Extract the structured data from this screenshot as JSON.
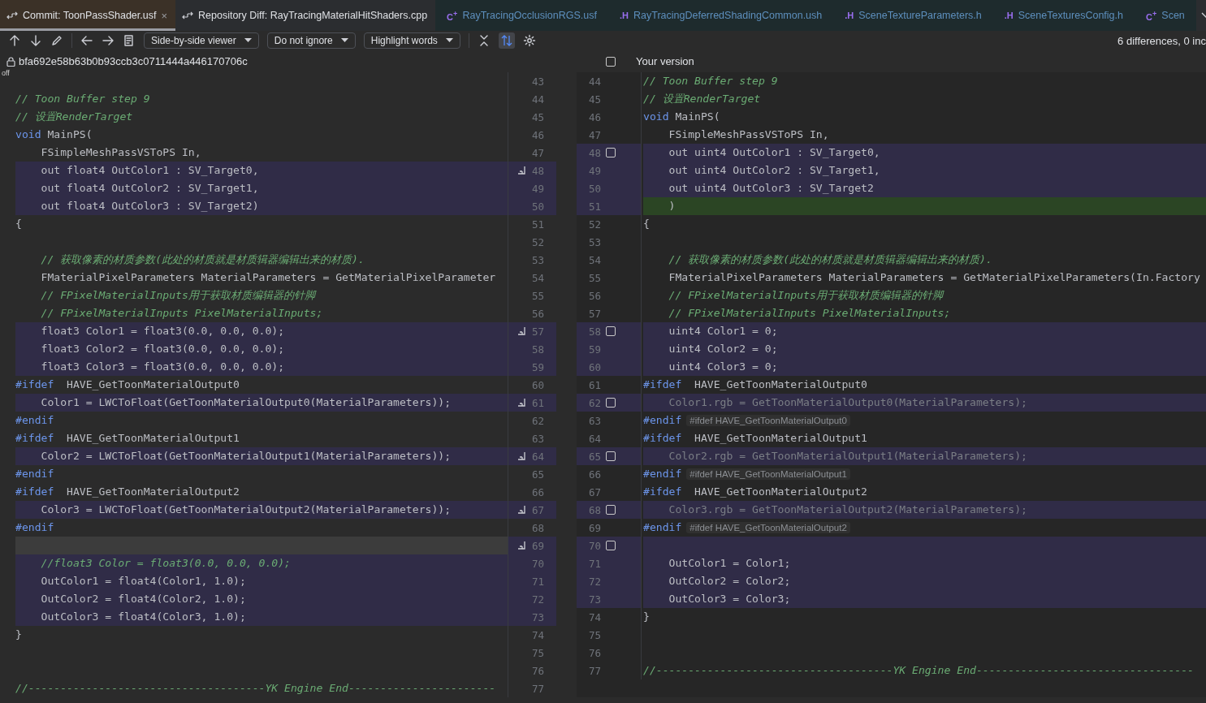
{
  "tabs": [
    {
      "label": "Commit: ToonPassShader.usf",
      "kind": "diff",
      "selected": true,
      "close": "×"
    },
    {
      "label": "Repository Diff: RayTracingMaterialHitShaders.cpp",
      "kind": "diff",
      "selected": false
    },
    {
      "label": "RayTracingOcclusionRGS.usf",
      "kind": "file",
      "badge": "C$^{+}$",
      "selected": false
    },
    {
      "label": "RayTracingDeferredShadingCommon.ush",
      "kind": "file",
      "badge": ".H",
      "selected": false
    },
    {
      "label": "SceneTextureParameters.h",
      "kind": "file",
      "badge": ".H",
      "selected": false
    },
    {
      "label": "SceneTexturesConfig.h",
      "kind": "file",
      "badge": ".H",
      "selected": false
    },
    {
      "label": "Scen",
      "kind": "file",
      "badge": "C$^{+}$",
      "selected": false
    }
  ],
  "toolbar": {
    "dropdowns": [
      "Side-by-side viewer",
      "Do not ignore",
      "Highlight words"
    ],
    "sync_scroll_on": true,
    "summary": "6 differences, 0 inc"
  },
  "left": {
    "revision": "bfa692e58b63b0b93ccb3c0711444a446170706c",
    "fold_label": "off",
    "lines": [
      {
        "no": "43",
        "kind": "blank",
        "changed": false
      },
      {
        "no": "44",
        "kind": "comment",
        "changed": false,
        "text": "// Toon Buffer step 9"
      },
      {
        "no": "45",
        "kind": "comment",
        "changed": false,
        "text": "// 设置RenderTarget"
      },
      {
        "no": "46",
        "kind": "keyword",
        "changed": false,
        "text": "void MainPS("
      },
      {
        "no": "47",
        "kind": "code",
        "changed": false,
        "text": "    FSimpleMeshPassVSToPS In,"
      },
      {
        "no": "48",
        "kind": "code",
        "changed": true,
        "apply": true,
        "text": "    out float4 OutColor1 : SV_Target0,"
      },
      {
        "no": "49",
        "kind": "code",
        "changed": true,
        "text": "    out float4 OutColor2 : SV_Target1,"
      },
      {
        "no": "50",
        "kind": "code",
        "changed": true,
        "text": "    out float4 OutColor3 : SV_Target2)"
      },
      {
        "no": "51",
        "kind": "code",
        "changed": false,
        "text": "{"
      },
      {
        "no": "52",
        "kind": "blank",
        "changed": false
      },
      {
        "no": "53",
        "kind": "comment",
        "changed": false,
        "text": "    // 获取像素的材质参数(此处的材质就是材质辑器编辑出来的材质)."
      },
      {
        "no": "54",
        "kind": "code",
        "changed": false,
        "text": "    FMaterialPixelParameters MaterialParameters = GetMaterialPixelParameter"
      },
      {
        "no": "55",
        "kind": "comment",
        "changed": false,
        "text": "    // FPixelMaterialInputs用于获取材质编辑器的针脚"
      },
      {
        "no": "56",
        "kind": "comment",
        "changed": false,
        "text": "    // FPixelMaterialInputs PixelMaterialInputs;"
      },
      {
        "no": "57",
        "kind": "code",
        "changed": true,
        "apply": true,
        "text": "    float3 Color1 = float3(0.0, 0.0, 0.0);"
      },
      {
        "no": "58",
        "kind": "code",
        "changed": true,
        "text": "    float3 Color2 = float3(0.0, 0.0, 0.0);"
      },
      {
        "no": "59",
        "kind": "code",
        "changed": true,
        "text": "    float3 Color3 = float3(0.0, 0.0, 0.0);"
      },
      {
        "no": "60",
        "kind": "keyword",
        "changed": false,
        "text": "#ifdef  HAVE_GetToonMaterialOutput0"
      },
      {
        "no": "61",
        "kind": "code",
        "changed": true,
        "apply": true,
        "text": "    Color1 = LWCToFloat(GetToonMaterialOutput0(MaterialParameters));"
      },
      {
        "no": "62",
        "kind": "keyword",
        "changed": false,
        "text": "#endif"
      },
      {
        "no": "63",
        "kind": "keyword",
        "changed": false,
        "text": "#ifdef  HAVE_GetToonMaterialOutput1"
      },
      {
        "no": "64",
        "kind": "code",
        "changed": true,
        "apply": true,
        "text": "    Color2 = LWCToFloat(GetToonMaterialOutput1(MaterialParameters));"
      },
      {
        "no": "65",
        "kind": "keyword",
        "changed": false,
        "text": "#endif"
      },
      {
        "no": "66",
        "kind": "keyword",
        "changed": false,
        "text": "#ifdef  HAVE_GetToonMaterialOutput2"
      },
      {
        "no": "67",
        "kind": "code",
        "changed": true,
        "apply": true,
        "text": "    Color3 = LWCToFloat(GetToonMaterialOutput2(MaterialParameters));"
      },
      {
        "no": "68",
        "kind": "keyword",
        "changed": false,
        "text": "#endif"
      },
      {
        "no": "69",
        "kind": "gap",
        "changed": true,
        "apply": true
      },
      {
        "no": "70",
        "kind": "comment",
        "changed": true,
        "text": "    //float3 Color = float3(0.0, 0.0, 0.0);"
      },
      {
        "no": "71",
        "kind": "code",
        "changed": true,
        "text": "    OutColor1 = float4(Color1, 1.0);"
      },
      {
        "no": "72",
        "kind": "code",
        "changed": true,
        "text": "    OutColor2 = float4(Color2, 1.0);"
      },
      {
        "no": "73",
        "kind": "code",
        "changed": true,
        "text": "    OutColor3 = float4(Color3, 1.0);"
      },
      {
        "no": "74",
        "kind": "code",
        "changed": false,
        "text": "}"
      },
      {
        "no": "75",
        "kind": "blank",
        "changed": false
      },
      {
        "no": "76",
        "kind": "blank",
        "changed": false
      },
      {
        "no": "77",
        "kind": "comment",
        "changed": false,
        "text": "//-------------------------------------YK Engine End-----------------------"
      }
    ]
  },
  "right": {
    "title": "Your version",
    "checked": false,
    "lines": [
      {
        "no": "44",
        "kind": "comment",
        "changed": false,
        "text": "// Toon Buffer step 9"
      },
      {
        "no": "45",
        "kind": "comment",
        "changed": false,
        "text": "// 设置RenderTarget"
      },
      {
        "no": "46",
        "kind": "keyword",
        "changed": false,
        "text": "void MainPS("
      },
      {
        "no": "47",
        "kind": "code",
        "changed": false,
        "text": "    FSimpleMeshPassVSToPS In,"
      },
      {
        "no": "48",
        "kind": "code",
        "changed": true,
        "checked": false,
        "text": "    out uint4 OutColor1 : SV_Target0,"
      },
      {
        "no": "49",
        "kind": "code",
        "changed": true,
        "text": "    out uint4 OutColor2 : SV_Target1,"
      },
      {
        "no": "50",
        "kind": "code",
        "changed": true,
        "text": "    out uint4 OutColor3 : SV_Target2"
      },
      {
        "no": "51",
        "kind": "added",
        "changed": true,
        "text": "    )"
      },
      {
        "no": "52",
        "kind": "code",
        "changed": false,
        "text": "{"
      },
      {
        "no": "53",
        "kind": "blank",
        "changed": false
      },
      {
        "no": "54",
        "kind": "comment",
        "changed": false,
        "text": "    // 获取像素的材质参数(此处的材质就是材质辑器编辑出来的材质)."
      },
      {
        "no": "55",
        "kind": "code",
        "changed": false,
        "text": "    FMaterialPixelParameters MaterialParameters = GetMaterialPixelParameters(In.Factory"
      },
      {
        "no": "56",
        "kind": "comment",
        "changed": false,
        "text": "    // FPixelMaterialInputs用于获取材质编辑器的针脚"
      },
      {
        "no": "57",
        "kind": "comment",
        "changed": false,
        "text": "    // FPixelMaterialInputs PixelMaterialInputs;"
      },
      {
        "no": "58",
        "kind": "code",
        "changed": true,
        "checked": false,
        "text": "    uint4 Color1 = 0;"
      },
      {
        "no": "59",
        "kind": "code",
        "changed": true,
        "text": "    uint4 Color2 = 0;"
      },
      {
        "no": "60",
        "kind": "code",
        "changed": true,
        "text": "    uint4 Color3 = 0;"
      },
      {
        "no": "61",
        "kind": "keyword",
        "changed": false,
        "text": "#ifdef  HAVE_GetToonMaterialOutput0"
      },
      {
        "no": "62",
        "kind": "inactive",
        "changed": true,
        "checked": false,
        "text": "    Color1.rgb = GetToonMaterialOutput0(MaterialParameters);"
      },
      {
        "no": "63",
        "kind": "keyword",
        "changed": false,
        "hint": "#ifdef HAVE_GetToonMaterialOutput0",
        "text": "#endif"
      },
      {
        "no": "64",
        "kind": "keyword",
        "changed": false,
        "text": "#ifdef  HAVE_GetToonMaterialOutput1"
      },
      {
        "no": "65",
        "kind": "inactive",
        "changed": true,
        "checked": false,
        "text": "    Color2.rgb = GetToonMaterialOutput1(MaterialParameters);"
      },
      {
        "no": "66",
        "kind": "keyword",
        "changed": false,
        "hint": "#ifdef HAVE_GetToonMaterialOutput1",
        "text": "#endif"
      },
      {
        "no": "67",
        "kind": "keyword",
        "changed": false,
        "text": "#ifdef  HAVE_GetToonMaterialOutput2"
      },
      {
        "no": "68",
        "kind": "inactive",
        "changed": true,
        "checked": false,
        "text": "    Color3.rgb = GetToonMaterialOutput2(MaterialParameters);"
      },
      {
        "no": "69",
        "kind": "keyword",
        "changed": false,
        "hint": "#ifdef HAVE_GetToonMaterialOutput2",
        "text": "#endif"
      },
      {
        "no": "70",
        "kind": "blank",
        "changed": true,
        "checked": false
      },
      {
        "no": "71",
        "kind": "code",
        "changed": true,
        "text": "    OutColor1 = Color1;"
      },
      {
        "no": "72",
        "kind": "code",
        "changed": true,
        "text": "    OutColor2 = Color2;"
      },
      {
        "no": "73",
        "kind": "code",
        "changed": true,
        "text": "    OutColor3 = Color3;"
      },
      {
        "no": "74",
        "kind": "code",
        "changed": false,
        "text": "}"
      },
      {
        "no": "75",
        "kind": "blank",
        "changed": false
      },
      {
        "no": "76",
        "kind": "blank",
        "changed": false
      },
      {
        "no": "77",
        "kind": "comment",
        "changed": false,
        "text": "//-------------------------------------YK Engine End----------------------------------"
      }
    ]
  }
}
